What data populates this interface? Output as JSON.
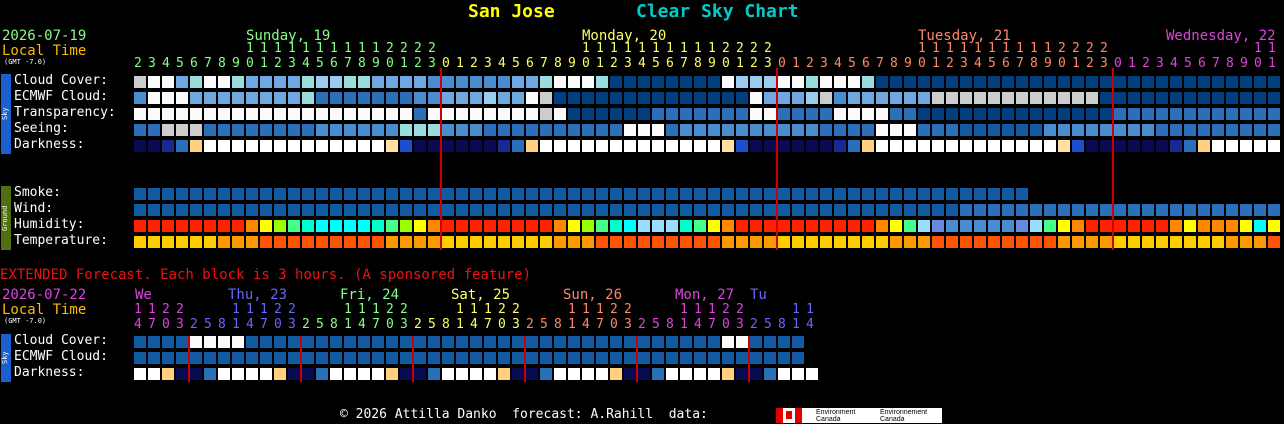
{
  "title": {
    "location": "San Jose",
    "chart_name": "Clear Sky Chart"
  },
  "main": {
    "date": "2026-07-19",
    "local_time_label": "Local Time",
    "gmt_offset": "(GMT -7.0)",
    "days": [
      {
        "label": "Sunday, 19",
        "color": "#88ff88"
      },
      {
        "label": "Monday, 20",
        "color": "#ffff66"
      },
      {
        "label": "Tuesday, 21",
        "color": "#ff8866"
      },
      {
        "label": "Wednesday, 22",
        "color": "#dd44dd"
      }
    ],
    "hours": [
      2,
      3,
      4,
      5,
      6,
      7,
      8,
      9,
      10,
      11,
      12,
      13,
      14,
      15,
      16,
      17,
      18,
      19,
      20,
      21,
      22,
      23,
      0,
      1,
      2,
      3,
      4,
      5,
      6,
      7,
      8,
      9,
      10,
      11,
      12,
      13,
      14,
      15,
      16,
      17,
      18,
      19,
      20,
      21,
      22,
      23,
      0,
      1,
      2,
      3,
      4,
      5,
      6,
      7,
      8,
      9,
      10,
      11,
      12,
      13,
      14,
      15,
      16,
      17,
      18,
      19,
      20,
      21,
      22,
      23,
      0,
      1,
      2,
      3,
      4,
      5,
      6,
      7,
      8,
      9,
      10,
      11
    ],
    "rows_sky": [
      "Cloud Cover:",
      "ECMWF Cloud:",
      "Transparency:",
      "Seeing:",
      "Darkness:"
    ],
    "rows_ground": [
      "Smoke:",
      "Wind:",
      "Humidity:",
      "Temperature:"
    ],
    "sky_group": "Sky",
    "ground_group": "Ground"
  },
  "extended": {
    "header": "EXTENDED Forecast. Each block is 3 hours. (A sponsored feature)",
    "date": "2026-07-22",
    "local_time_label": "Local Time",
    "gmt_offset": "(GMT -7.0)",
    "days": [
      {
        "label": "We",
        "color": "#dd44dd"
      },
      {
        "label": "Thu, 23",
        "color": "#6666ff"
      },
      {
        "label": "Fri, 24",
        "color": "#88ff88"
      },
      {
        "label": "Sat, 25",
        "color": "#ffff66"
      },
      {
        "label": "Sun, 26",
        "color": "#ff8866"
      },
      {
        "label": "Mon, 27",
        "color": "#dd44dd"
      },
      {
        "label": "Tu",
        "color": "#6666ff"
      }
    ],
    "hours": [
      14,
      17,
      20,
      23,
      2,
      5,
      8,
      11,
      14,
      17,
      20,
      23,
      2,
      5,
      8,
      11,
      14,
      17,
      20,
      23,
      2,
      5,
      8,
      11,
      14,
      17,
      20,
      23,
      2,
      5,
      8,
      11,
      14,
      17,
      20,
      23,
      2,
      5,
      8,
      11,
      14,
      17,
      20,
      23,
      2,
      5,
      8,
      11,
      14
    ],
    "rows": [
      "Cloud Cover:",
      "ECMWF Cloud:",
      "Darkness:"
    ],
    "sky_group": "Sky"
  },
  "footer": {
    "text": "© 2026 Attilla Danko  forecast: A.Rahill  data:",
    "logo_text_en": "Environment\nCanada",
    "logo_text_fr": "Environnement\nCanada"
  },
  "colors": {
    "cloud_clear": "#003e7e",
    "cloud_full": "#fbfbfb",
    "transparency_poor": "#ffffff",
    "seeing_excellent": "#003e7e",
    "darkness_dark": "#000000",
    "humidity_high": "#d00000",
    "temperature_warm": "#ff6600",
    "midnight_line": "#cc0000"
  }
}
